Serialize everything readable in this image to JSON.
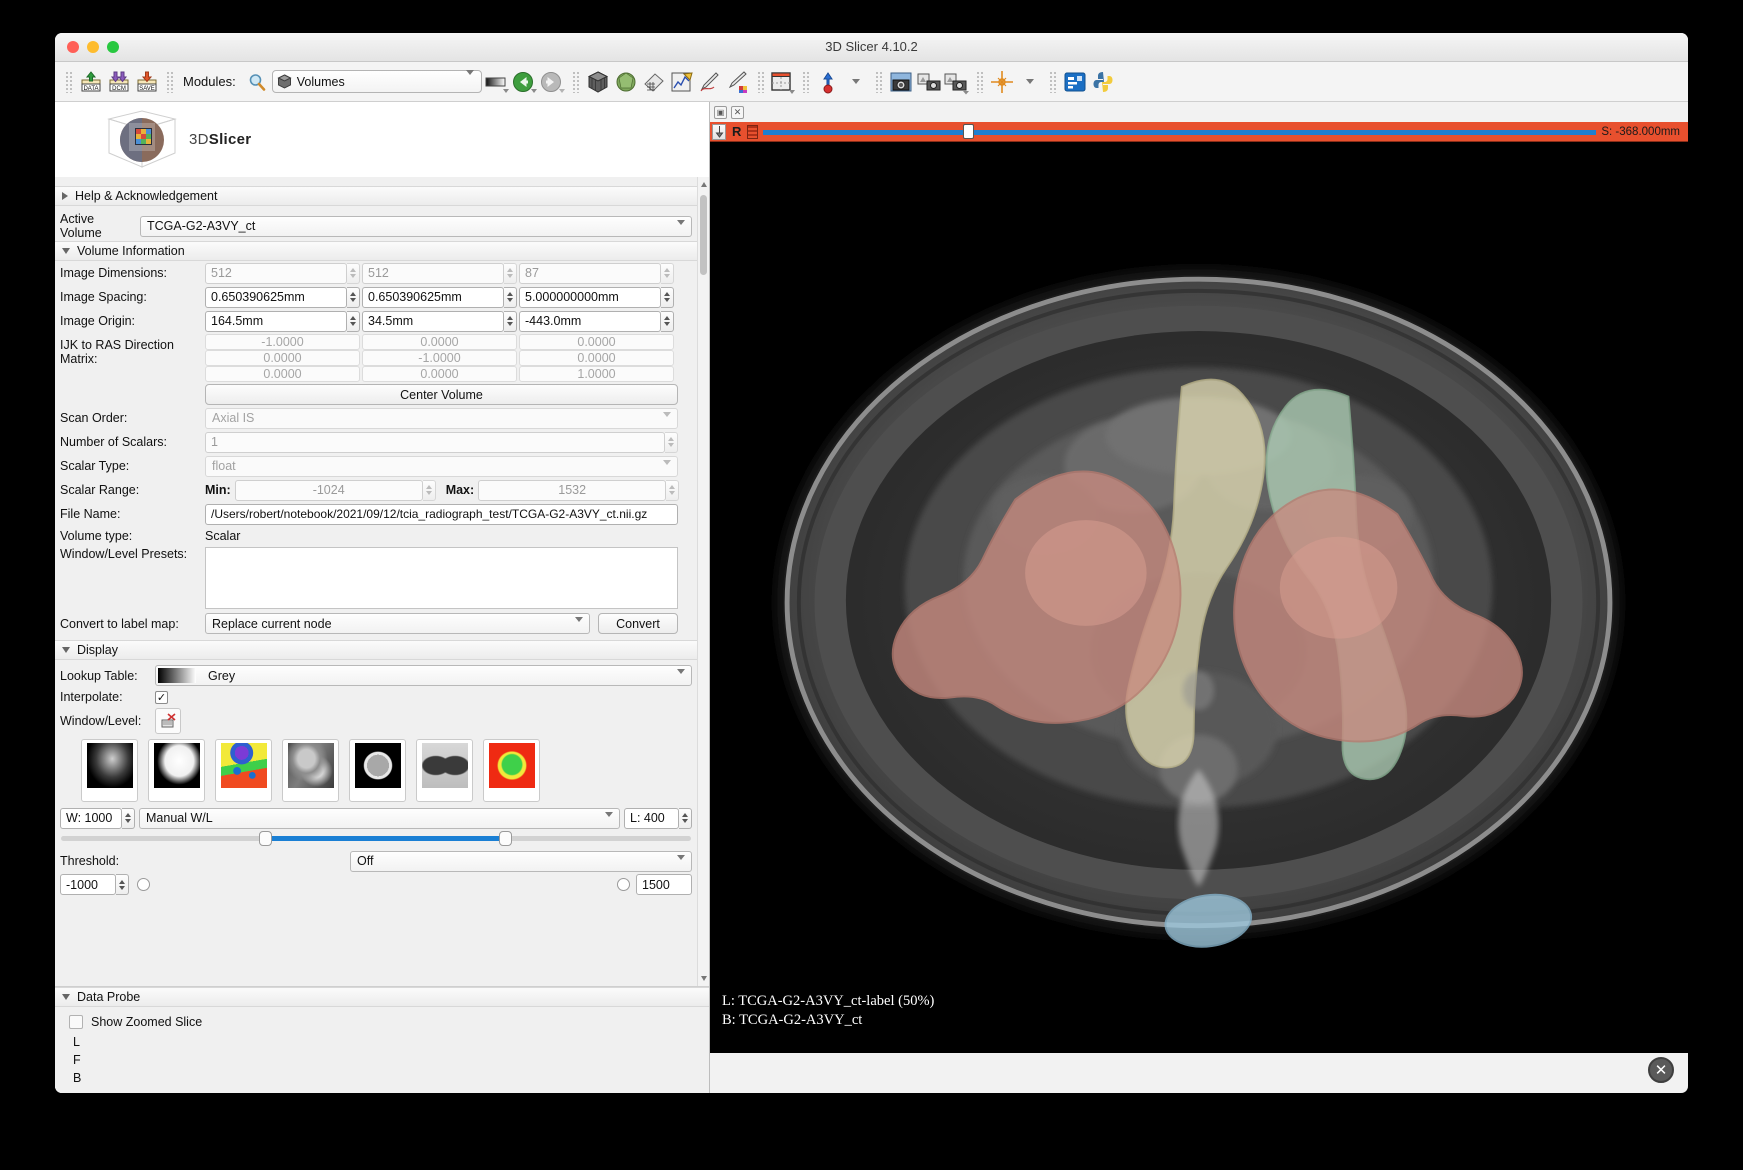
{
  "window": {
    "title": "3D Slicer 4.10.2"
  },
  "toolbar": {
    "load_data_label": "DATA",
    "load_dicom_label": "DCM",
    "save_label": "SAVE",
    "modules_label": "Modules:",
    "module_selected": "Volumes",
    "icons": [
      "load-data-icon",
      "load-dicom-icon",
      "save-data-icon",
      "colormap-icon",
      "back-icon",
      "forward-icon",
      "volume-rendering-icon",
      "models-icon",
      "markups-icon",
      "annotations-icon",
      "editor-icon",
      "segment-editor-icon",
      "layout-icon",
      "mouse-mode-icon",
      "screenshot-icon",
      "scene-views-icon",
      "scene-views-capture-icon",
      "crosshair-icon",
      "extension-manager-icon",
      "python-console-icon"
    ]
  },
  "logo": {
    "text_prefix": "3D",
    "text_suffix": "Slicer"
  },
  "panel": {
    "help_section": "Help & Acknowledgement",
    "active_volume_label": "Active Volume",
    "active_volume_value": "TCGA-G2-A3VY_ct",
    "volume_information": {
      "title": "Volume Information",
      "image_dimensions_label": "Image Dimensions:",
      "image_dimensions": [
        "512",
        "512",
        "87"
      ],
      "image_spacing_label": "Image Spacing:",
      "image_spacing": [
        "0.650390625mm",
        "0.650390625mm",
        "5.000000000mm"
      ],
      "image_origin_label": "Image Origin:",
      "image_origin": [
        "164.5mm",
        "34.5mm",
        "-443.0mm"
      ],
      "ijk_to_ras_label": "IJK to RAS Direction Matrix:",
      "ijk_to_ras": [
        [
          "-1.0000",
          "0.0000",
          "0.0000"
        ],
        [
          "0.0000",
          "-1.0000",
          "0.0000"
        ],
        [
          "0.0000",
          "0.0000",
          "1.0000"
        ]
      ],
      "center_volume_label": "Center Volume",
      "scan_order_label": "Scan Order:",
      "scan_order_value": "Axial IS",
      "number_of_scalars_label": "Number of Scalars:",
      "number_of_scalars_value": "1",
      "scalar_type_label": "Scalar Type:",
      "scalar_type_value": "float",
      "scalar_range_label": "Scalar Range:",
      "scalar_min_label": "Min:",
      "scalar_min_value": "-1024",
      "scalar_max_label": "Max:",
      "scalar_max_value": "1532",
      "file_name_label": "File Name:",
      "file_name_value": "/Users/robert/notebook/2021/09/12/tcia_radiograph_test/TCGA-G2-A3VY_ct.nii.gz",
      "volume_type_label": "Volume type:",
      "volume_type_value": "Scalar",
      "window_level_presets_label": "Window/Level Presets:",
      "window_level_presets_value": "",
      "convert_label": "Convert to label map:",
      "convert_value": "Replace current node",
      "convert_button": "Convert"
    },
    "display": {
      "title": "Display",
      "lookup_table_label": "Lookup Table:",
      "lookup_table_value": "Grey",
      "interpolate_label": "Interpolate:",
      "interpolate_checked": "✓",
      "window_level_label": "Window/Level:",
      "preset_names": [
        "ct-bone-preset",
        "ct-air-preset",
        "pet-preset",
        "ct-abdomen-preset",
        "ct-brain-preset",
        "ct-lung-preset",
        "dtibrain-preset"
      ],
      "window_value": "W: 1000",
      "wl_mode": "Manual W/L",
      "level_value": "L: 400",
      "threshold_label": "Threshold:",
      "threshold_value": "Off"
    },
    "data_probe": {
      "title": "Data Probe",
      "show_zoomed_slice_label": "Show Zoomed Slice",
      "rows": [
        "L",
        "F",
        "B"
      ]
    }
  },
  "slice": {
    "orientation_letter": "R",
    "offset_value": "S: -368.000mm",
    "pin_icon": "pin-icon",
    "maximize_icon": "maximize-icon",
    "close_icon": "close-view-icon",
    "bar_color": "#e8502e",
    "overlay_labels": [
      "L: TCGA-G2-A3VY_ct-label (50%)",
      "B: TCGA-G2-A3VY_ct"
    ],
    "segment_colors": {
      "bone_left": "#ddd6a6",
      "bone_right": "#a8ceb0",
      "muscle": "#c98b80",
      "bladder": "#9ec8dd"
    }
  },
  "bottom": {
    "close_button_label": "✕"
  }
}
